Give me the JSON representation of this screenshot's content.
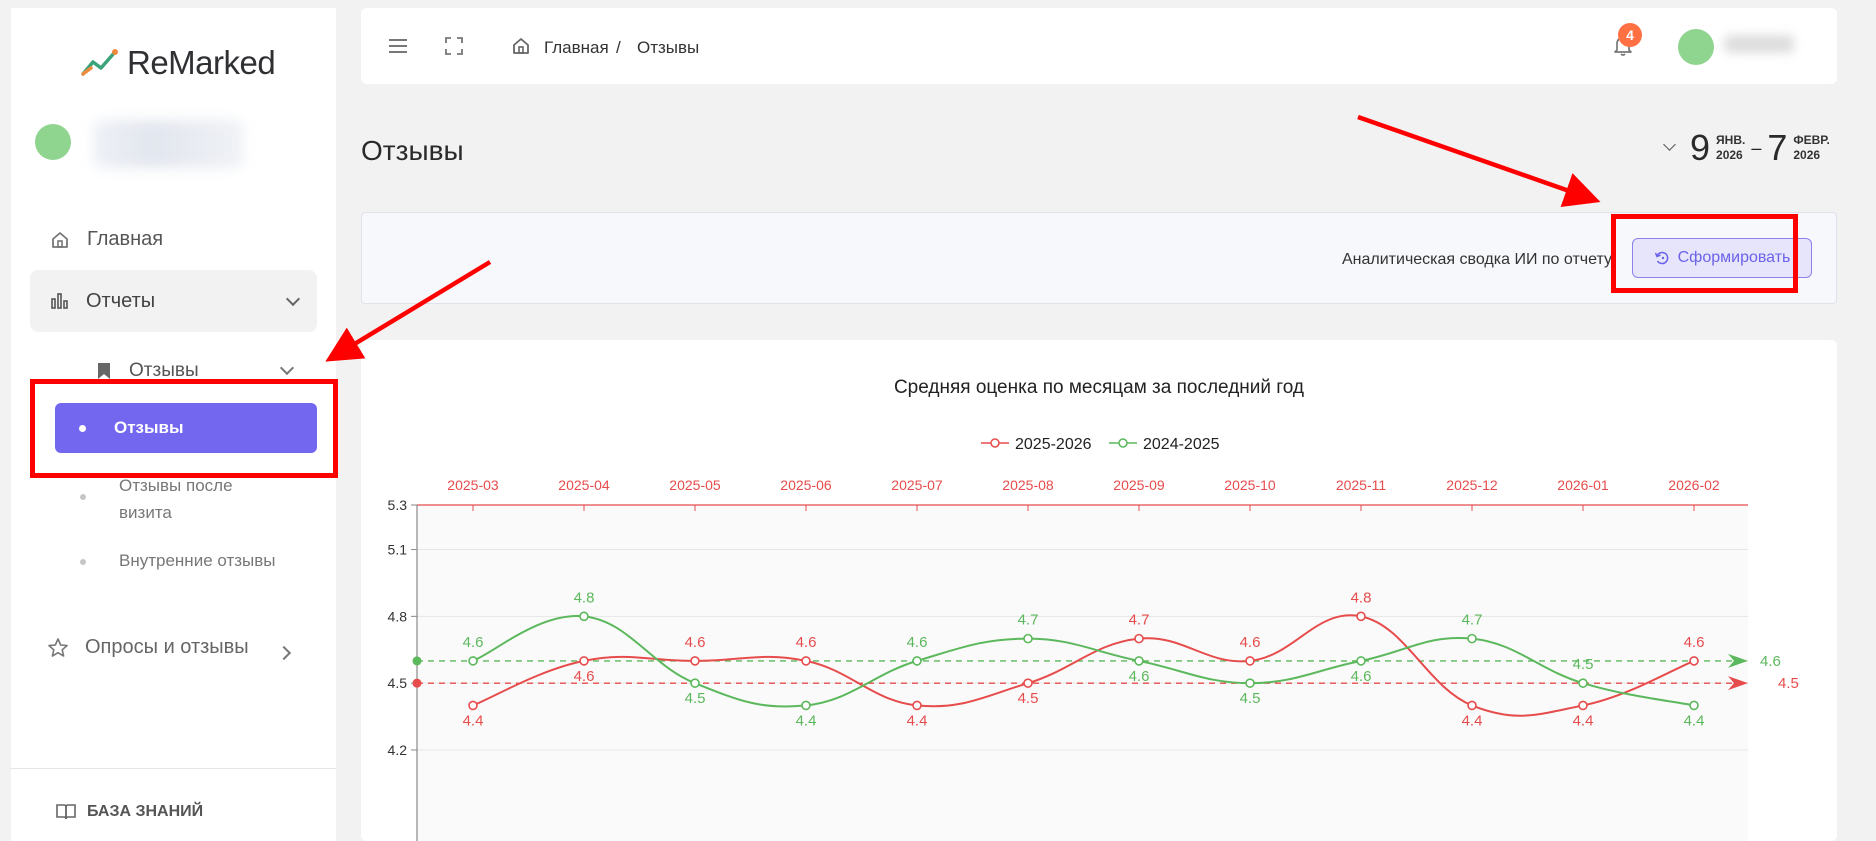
{
  "app": {
    "logo_text": "ReMarked"
  },
  "sidebar": {
    "home_label": "Главная",
    "reports_label": "Отчеты",
    "reviews_group_label": "Отзывы",
    "active_item_label": "Отзывы",
    "after_visit_line1": "Отзывы после",
    "after_visit_line2": "визита",
    "internal_label": "Внутренние отзывы",
    "surveys_label": "Опросы и отзывы",
    "knowledge_label": "БАЗА ЗНАНИЙ"
  },
  "header": {
    "breadcrumb_home": "Главная",
    "breadcrumb_sep": "/",
    "breadcrumb_current": "Отзывы",
    "notification_count": "4"
  },
  "page": {
    "title": "Отзывы",
    "date_from_day": "9",
    "date_from_month": "ЯНВ.",
    "date_from_year": "2026",
    "date_dash": "–",
    "date_to_day": "7",
    "date_to_month": "ФЕВР.",
    "date_to_year": "2026"
  },
  "summary": {
    "label": "Аналитическая сводка ИИ по отчету",
    "button_label": "Сформировать"
  },
  "colors": {
    "accent": "#7367f0",
    "series_current": "#e74c4c",
    "series_previous": "#5cb85c",
    "annotation": "#ff0000"
  },
  "chart_data": {
    "type": "line",
    "title": "Средняя оценка по месяцам за последний год",
    "categories": [
      "2025-03",
      "2025-04",
      "2025-05",
      "2025-06",
      "2025-07",
      "2025-08",
      "2025-09",
      "2025-10",
      "2025-11",
      "2025-12",
      "2026-01",
      "2026-02"
    ],
    "series": [
      {
        "name": "2025-2026",
        "color": "#e74c4c",
        "values": [
          4.4,
          4.6,
          4.6,
          4.6,
          4.4,
          4.5,
          4.7,
          4.6,
          4.8,
          4.4,
          4.4,
          4.6
        ],
        "average": 4.5
      },
      {
        "name": "2024-2025",
        "color": "#5cb85c",
        "values": [
          4.6,
          4.8,
          4.5,
          4.4,
          4.6,
          4.7,
          4.6,
          4.5,
          4.6,
          4.7,
          4.5,
          4.4
        ],
        "average": 4.6
      }
    ],
    "y_ticks": [
      5.3,
      5.1,
      4.8,
      4.5,
      4.2
    ],
    "ylim": [
      4.2,
      5.3
    ],
    "legend_position": "top-center",
    "category_axis": "top",
    "grid": true
  }
}
